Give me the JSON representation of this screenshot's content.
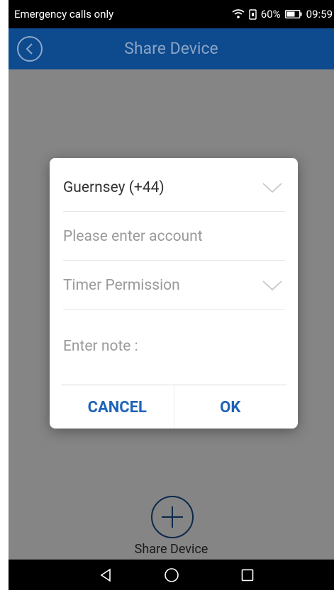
{
  "status_bar": {
    "carrier_text": "Emergency calls only",
    "battery_percent": "60%",
    "time": "09:59"
  },
  "app_bar": {
    "title": "Share Device"
  },
  "dialog": {
    "country_select": "Guernsey (+44)",
    "account_placeholder": "Please enter account",
    "permission_select": "Timer Permission",
    "note_placeholder": "Enter note :",
    "cancel_label": "CANCEL",
    "ok_label": "OK"
  },
  "share": {
    "label": "Share Device"
  },
  "colors": {
    "app_bar": "#0d4a8e",
    "accent": "#1e63b8"
  },
  "icons": [
    "back-icon",
    "wifi-icon",
    "sim-icon",
    "battery-icon",
    "chevron-down-icon",
    "add-circle-icon",
    "nav-back-icon",
    "nav-home-icon",
    "nav-recents-icon"
  ]
}
